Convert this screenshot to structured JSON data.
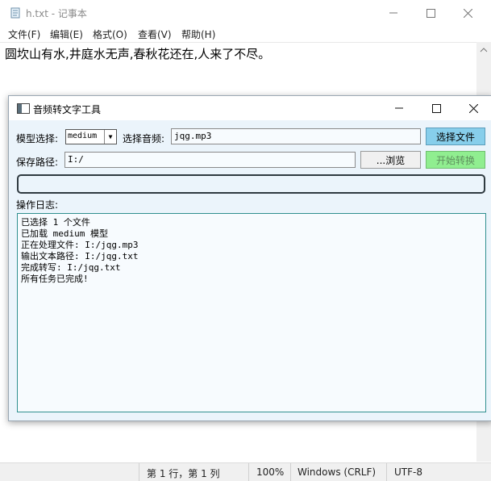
{
  "notepad": {
    "title": "h.txt - 记事本",
    "menu": [
      "文件(F)",
      "编辑(E)",
      "格式(O)",
      "查看(V)",
      "帮助(H)"
    ],
    "content": "圆坎山有水,井庭水无声,春秋花还在,人来了不尽。",
    "status": {
      "position": "第 1 行，第 1 列",
      "zoom": "100%",
      "line_ending": "Windows (CRLF)",
      "encoding": "UTF-8"
    }
  },
  "dialog": {
    "title": "音频转文字工具",
    "model_label": "模型选择:",
    "model_value": "medium",
    "audio_label": "选择音频:",
    "audio_value": "jqg.mp3",
    "select_button": "选择文件",
    "save_label": "保存路径:",
    "save_value": "I:/",
    "browse_button": "...浏览",
    "start_button": "开始转换",
    "progress": 0,
    "log_label": "操作日志:",
    "log_lines": [
      "已选择 1 个文件",
      "已加载 medium 模型",
      "正在处理文件: I:/jqg.mp3",
      "输出文本路径: I:/jqg.txt",
      "完成转写: I:/jqg.txt",
      "所有任务已完成!"
    ]
  },
  "colors": {
    "select_button": "#87ceeb",
    "start_button": "#90ee90",
    "dialog_bg": "#ebf4fb",
    "log_border": "#2f8f8f"
  }
}
